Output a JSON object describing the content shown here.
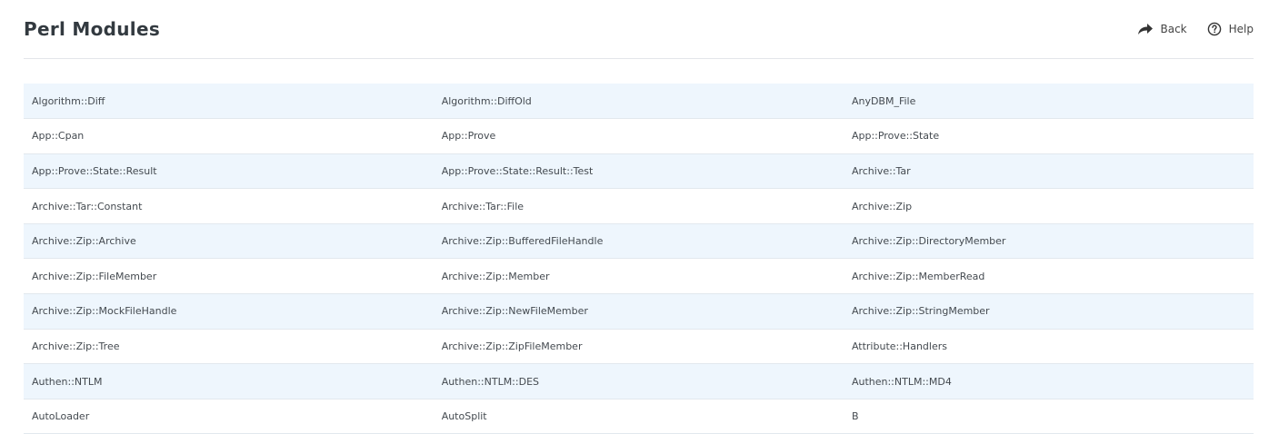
{
  "header": {
    "title": "Perl Modules",
    "back_label": "Back",
    "help_label": "Help"
  },
  "modules": {
    "rows": [
      [
        "Algorithm::Diff",
        "Algorithm::DiffOld",
        "AnyDBM_File"
      ],
      [
        "App::Cpan",
        "App::Prove",
        "App::Prove::State"
      ],
      [
        "App::Prove::State::Result",
        "App::Prove::State::Result::Test",
        "Archive::Tar"
      ],
      [
        "Archive::Tar::Constant",
        "Archive::Tar::File",
        "Archive::Zip"
      ],
      [
        "Archive::Zip::Archive",
        "Archive::Zip::BufferedFileHandle",
        "Archive::Zip::DirectoryMember"
      ],
      [
        "Archive::Zip::FileMember",
        "Archive::Zip::Member",
        "Archive::Zip::MemberRead"
      ],
      [
        "Archive::Zip::MockFileHandle",
        "Archive::Zip::NewFileMember",
        "Archive::Zip::StringMember"
      ],
      [
        "Archive::Zip::Tree",
        "Archive::Zip::ZipFileMember",
        "Attribute::Handlers"
      ],
      [
        "Authen::NTLM",
        "Authen::NTLM::DES",
        "Authen::NTLM::MD4"
      ],
      [
        "AutoLoader",
        "AutoSplit",
        "B"
      ]
    ]
  }
}
